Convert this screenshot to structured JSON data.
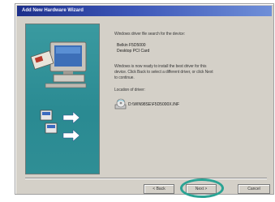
{
  "window": {
    "title": "Add New Hardware Wizard"
  },
  "main": {
    "intro": "Windows driver file search for the device:",
    "device_lines": [
      "Belkin F5D5000",
      "Desktop PCI Card"
    ],
    "instructions": [
      "Windows is now ready to install the best driver for this",
      "device. Click Back to select a different driver, or click Next",
      "to continue."
    ],
    "location_label": "Location of driver:",
    "driver_path": "D:\\WIN98SE\\F5D5000X.INF"
  },
  "buttons": {
    "back": "< Back",
    "next": "Next >",
    "cancel": "Cancel"
  },
  "icons": {
    "art": "computer-with-installer-disks-illustration",
    "location": "cd-drive-disk-icon"
  },
  "colors": {
    "titlebar": "#1c2f8a",
    "art_background": "#3a9aa0",
    "highlight_ring": "#2aa394",
    "dialog_face": "#d4d0c8"
  }
}
